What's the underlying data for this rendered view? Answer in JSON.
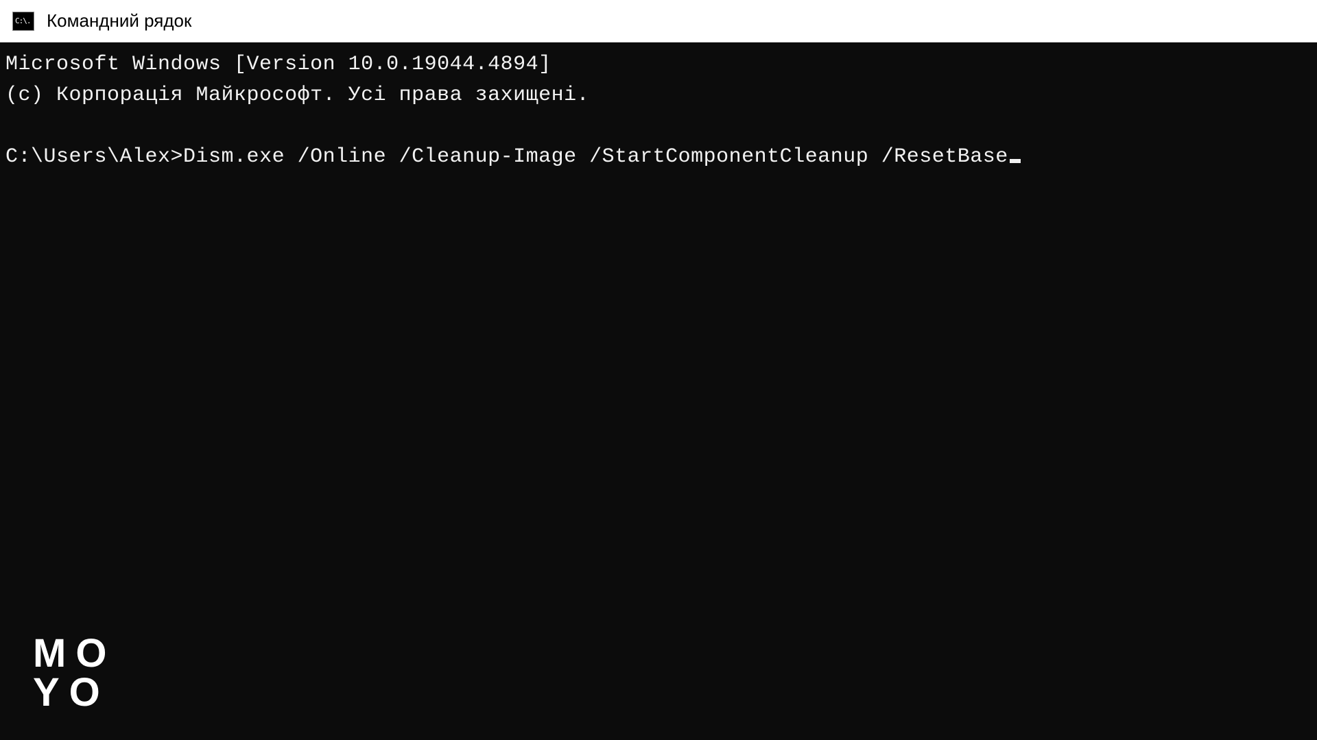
{
  "titlebar": {
    "icon_text": "C:\\.",
    "title": "Командний рядок"
  },
  "terminal": {
    "version_line": "Microsoft Windows [Version 10.0.19044.4894]",
    "copyright_line": "(c) Корпорація Майкрософт. Усі права захищені.",
    "blank_line": "",
    "prompt": "C:\\Users\\Alex>",
    "command": "Dism.exe /Online /Cleanup-Image /StartComponentCleanup /ResetBase"
  },
  "watermark": {
    "line1": "MO",
    "line2": "YO"
  }
}
